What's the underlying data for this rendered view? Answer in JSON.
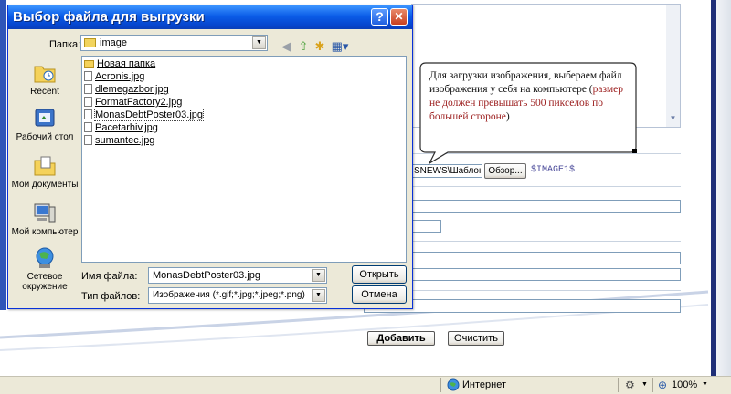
{
  "dialog": {
    "title": "Выбор файла для выгрузки",
    "help_label": "?",
    "close_label": "✕",
    "look_in_label": "Папка:",
    "look_in_value": "image",
    "places": [
      {
        "label": "Recent"
      },
      {
        "label": "Рабочий стол"
      },
      {
        "label": "Мои документы"
      },
      {
        "label": "Мой компьютер"
      },
      {
        "label": "Сетевое окружение"
      }
    ],
    "files": [
      {
        "name": "Новая папка",
        "kind": "folder"
      },
      {
        "name": "Acronis.jpg",
        "kind": "file"
      },
      {
        "name": "dlemegazbor.jpg",
        "kind": "file"
      },
      {
        "name": "FormatFactory2.jpg",
        "kind": "file"
      },
      {
        "name": "MonasDebtPoster03.jpg",
        "kind": "file"
      },
      {
        "name": "Pacetarhiv.jpg",
        "kind": "file"
      },
      {
        "name": "sumantec.jpg",
        "kind": "file"
      }
    ],
    "filename_label": "Имя файла:",
    "filename_value": "MonasDebtPoster03.jpg",
    "filetype_label": "Тип файлов:",
    "filetype_value": "Изображения (*.gif;*.jpg;*.jpeg;*.png)",
    "open_label": "Открыть",
    "cancel_label": "Отмена"
  },
  "callout": {
    "text": "Для загрузки изображения, выбераем файл изображения у себя на компьютере (",
    "highlight": "размер не должен превышать 500 пикселов по большей стороне",
    "tail": ")",
    "highlight_color": "#9b1c1c"
  },
  "form": {
    "path_value": "SNEWS\\Шаблоны",
    "browse_label": "Обзор...",
    "image_tag": "$IMAGE1$",
    "add_label": "Добавить",
    "clear_label": "Очистить"
  },
  "statusbar": {
    "zone": "Интернет",
    "zoom": "100%"
  }
}
